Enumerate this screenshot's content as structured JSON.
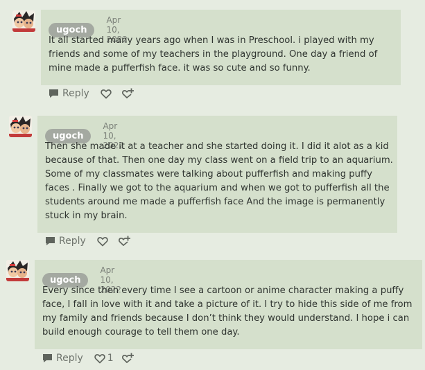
{
  "comments": [
    {
      "username": "ugoch",
      "date": "Apr 10, 2022",
      "lines": [
        "It all started many years ago when I was in Preschool. i played with my",
        "friends and some of my teachers in the playground. One day a friend of",
        "mine made a pufferfish face. it was so cute and so funny."
      ],
      "reply_label": "Reply",
      "like_count": ""
    },
    {
      "username": "ugoch",
      "date": "Apr 10, 2022",
      "lines": [
        "Then she made it at a teacher and she started doing it. I did it alot as a kid",
        "because of that. Then one day my class went on a field trip to an aquarium.",
        "Some of my classmates were talking about pufferfish and making puffy",
        "faces . Finally we got to the aquarium and when we got to pufferfish all the",
        "students around me made a pufferfish face And the image is permanently",
        "stuck in my brain."
      ],
      "reply_label": "Reply",
      "like_count": ""
    },
    {
      "username": "ugoch",
      "date": "Apr 10, 2022",
      "lines": [
        "Every since then every time I see a cartoon or anime character making a puffy",
        "face, I fall in love with it and take a picture of it. I try to hide this side of me from",
        "my family and friends because I don’t think they would understand. I hope i can",
        "build enough courage to tell them one day."
      ],
      "reply_label": "Reply",
      "like_count": "1"
    }
  ],
  "icons": {
    "reply": "speech-bubble-icon",
    "like": "heart-icon",
    "react": "add-reaction-icon"
  },
  "colors": {
    "background": "#e6ece1",
    "bubble": "#d5e0cc",
    "username_badge": "#a4a9a1",
    "text": "#2f3430",
    "muted": "#7b8079"
  }
}
